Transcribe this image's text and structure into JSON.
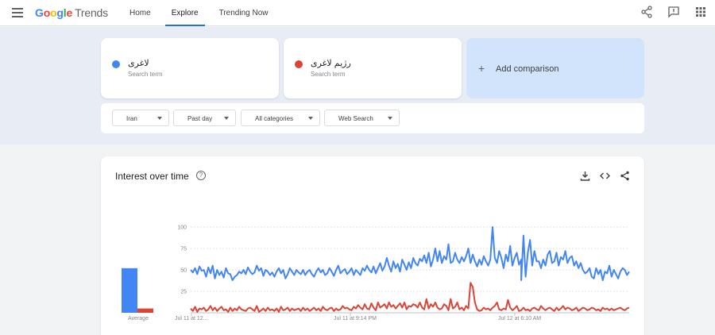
{
  "header": {
    "logo_google": "Google",
    "logo_trends": "Trends",
    "nav": [
      "Home",
      "Explore",
      "Trending Now"
    ],
    "active_nav": "Explore"
  },
  "terms": [
    {
      "name": "لاغری",
      "sub": "Search term",
      "color": "#4285f4"
    },
    {
      "name": "رژیم لاغری",
      "sub": "Search term",
      "color": "#db4437"
    }
  ],
  "add_comparison": "Add comparison",
  "filters": [
    "Iran",
    "Past day",
    "All categories",
    "Web Search"
  ],
  "interest": {
    "title": "Interest over time",
    "help": "?"
  },
  "chart_data": {
    "type": "line",
    "y_ticks": [
      100,
      75,
      50,
      25
    ],
    "ylim": [
      0,
      100
    ],
    "x_tick_labels": [
      "Jul 11 at 12...",
      "Jul 11 at 9:14 PM",
      "Jul 12 at 6:10 AM"
    ],
    "average_label": "Average",
    "averages": [
      {
        "name": "لاغری",
        "value": 52
      },
      {
        "name": "رژیم لاغری",
        "value": 5
      }
    ],
    "series": [
      {
        "name": "لاغری",
        "color": "#4285f4",
        "values": [
          50,
          47,
          52,
          45,
          54,
          49,
          50,
          42,
          53,
          46,
          55,
          40,
          50,
          44,
          48,
          41,
          52,
          46,
          45,
          38,
          42,
          44,
          48,
          46,
          50,
          45,
          53,
          48,
          45,
          47,
          55,
          49,
          52,
          43,
          50,
          48,
          44,
          47,
          42,
          48,
          52,
          46,
          50,
          40,
          45,
          52,
          48,
          44,
          50,
          47,
          45,
          50,
          44,
          48,
          50,
          45,
          42,
          48,
          52,
          47,
          50,
          44,
          46,
          52,
          48,
          43,
          50,
          55,
          46,
          49,
          51,
          45,
          48,
          52,
          44,
          50,
          47,
          44,
          52,
          49,
          55,
          50,
          47,
          54,
          46,
          52,
          58,
          49,
          54,
          64,
          55,
          48,
          60,
          52,
          57,
          48,
          62,
          56,
          50,
          59,
          52,
          64,
          58,
          55,
          63,
          60,
          67,
          58,
          70,
          54,
          62,
          75,
          60,
          72,
          58,
          66,
          62,
          80,
          58,
          60,
          70,
          62,
          58,
          65,
          60,
          66,
          75,
          58,
          68,
          60,
          54,
          62,
          56,
          66,
          60,
          55,
          62,
          100,
          64,
          58,
          72,
          64,
          52,
          68,
          60,
          78,
          55,
          64,
          70,
          56,
          62,
          90,
          42,
          70,
          85,
          55,
          72,
          60,
          60,
          52,
          62,
          55,
          68,
          72,
          58,
          60,
          70,
          55,
          65,
          62,
          72,
          58,
          64,
          66,
          55,
          60,
          52,
          58,
          50,
          46,
          48,
          52,
          42,
          40,
          52,
          45,
          50,
          38,
          48,
          46,
          55,
          42,
          50,
          45,
          40,
          48,
          52,
          50,
          44,
          48
        ],
        "dip": {
          "index": 150,
          "value": 38
        }
      },
      {
        "name": "رژیم لاغری",
        "color": "#db4437",
        "values": [
          5,
          2,
          7,
          1,
          5,
          4,
          6,
          2,
          4,
          8,
          3,
          6,
          2,
          5,
          7,
          3,
          4,
          1,
          6,
          2,
          5,
          3,
          7,
          4,
          3,
          2,
          5,
          6,
          4,
          2,
          8,
          1,
          3,
          5,
          2,
          6,
          3,
          4,
          2,
          5,
          1,
          7,
          3,
          4,
          6,
          2,
          5,
          3,
          4,
          5,
          2,
          6,
          3,
          5,
          2,
          4,
          6,
          3,
          5,
          2,
          7,
          4,
          3,
          5,
          6,
          2,
          5,
          3,
          4,
          8,
          5,
          6,
          4,
          3,
          7,
          5,
          9,
          6,
          4,
          10,
          5,
          4,
          11,
          6,
          3,
          12,
          6,
          8,
          10,
          5,
          12,
          7,
          9,
          5,
          8,
          11,
          6,
          12,
          4,
          8,
          7,
          10,
          9,
          6,
          12,
          6,
          4,
          16,
          5,
          10,
          7,
          12,
          6,
          4,
          5,
          10,
          8,
          3,
          16,
          5,
          7,
          12,
          4,
          6,
          3,
          8,
          5,
          35,
          30,
          12,
          4,
          2,
          3,
          6,
          4,
          5,
          3,
          6,
          8,
          12,
          4,
          3,
          5,
          4,
          15,
          6,
          3,
          5,
          8,
          2,
          3,
          6,
          3,
          4,
          2,
          5,
          6,
          4,
          3,
          8,
          5,
          3,
          5,
          6,
          4,
          2,
          6,
          3,
          5,
          8,
          4,
          6,
          5,
          3,
          4,
          6,
          2,
          4,
          6,
          5,
          3,
          4,
          6,
          5,
          3,
          4,
          2,
          6,
          4,
          5,
          3,
          5,
          3,
          4,
          5,
          6,
          4,
          3,
          5,
          6
        ]
      }
    ]
  }
}
